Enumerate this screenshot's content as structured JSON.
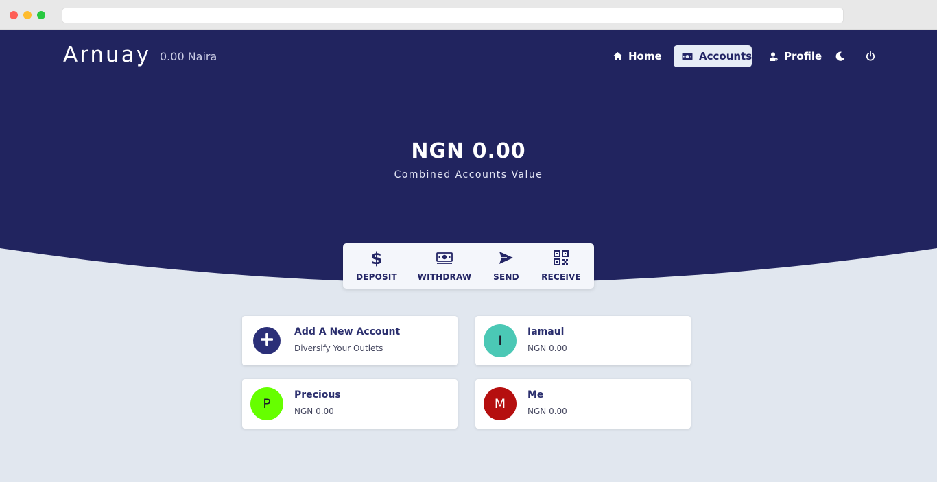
{
  "brand": {
    "name": "Arnuay",
    "balance": "0.00 Naira"
  },
  "nav": [
    {
      "label": "Home",
      "icon": "home-icon"
    },
    {
      "label": "Accounts",
      "icon": "money-bill-icon",
      "active": true
    },
    {
      "label": "Profile",
      "icon": "user-gear-icon"
    },
    {
      "label": "",
      "icon": "moon-icon"
    },
    {
      "label": "",
      "icon": "power-icon"
    }
  ],
  "summary": {
    "amount": "NGN 0.00",
    "caption": "Combined Accounts Value"
  },
  "actions": [
    {
      "label": "DEPOSIT",
      "icon": "dollar-icon"
    },
    {
      "label": "WITHDRAW",
      "icon": "money-bill-icon"
    },
    {
      "label": "SEND",
      "icon": "paper-plane-icon"
    },
    {
      "label": "RECEIVE",
      "icon": "qr-code-icon"
    }
  ],
  "accounts": [
    {
      "title": "Add A New Account",
      "subtitle": "Diversify Your Outlets",
      "icon": "plus-icon",
      "color": "#2b2f78"
    },
    {
      "title": "Iamaul",
      "subtitle": "NGN 0.00",
      "initial": "I",
      "color": "#4bc8b5"
    },
    {
      "title": "Precious",
      "subtitle": "NGN 0.00",
      "initial": "P",
      "color": "#66ff00"
    },
    {
      "title": "Me",
      "subtitle": "NGN 0.00",
      "initial": "M",
      "color": "#b50f0f"
    }
  ],
  "colors": {
    "header": "#21245f",
    "page": "#e1e7ef",
    "accent": "#2b2f6e"
  }
}
